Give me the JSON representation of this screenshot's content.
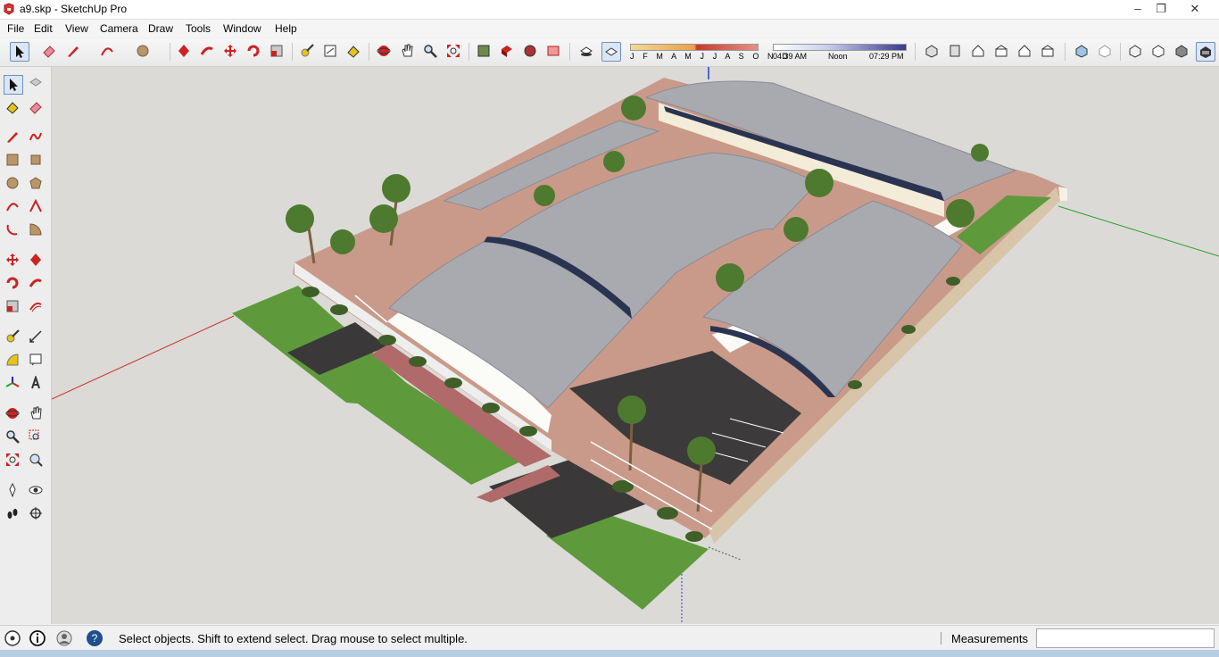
{
  "window": {
    "title": "a9.skp - SketchUp Pro",
    "controls": [
      "–",
      "❐",
      "✕"
    ]
  },
  "menu": [
    "File",
    "Edit",
    "View",
    "Camera",
    "Draw",
    "Tools",
    "Window",
    "Help"
  ],
  "toolbar": {
    "shadow_months": "J F M A M J J A S O N D",
    "time_start": "04:39 AM",
    "time_mid": "Noon",
    "time_end": "07:29 PM"
  },
  "status": {
    "hint": "Select objects. Shift to extend select. Drag mouse to select multiple.",
    "measurements_label": "Measurements",
    "measurements_value": ""
  },
  "colors": {
    "roof": "#a8aab0",
    "grass": "#5e9a3c",
    "paving": "#3c3a3a",
    "walk": "#b06a6a",
    "wall": "#fbfbf8",
    "sky": "#dcdad6"
  },
  "icons": [
    "select-icon",
    "eraser-icon",
    "pencil-icon",
    "arc-icon",
    "rectangle-icon",
    "circle-icon",
    "move-icon",
    "rotate-icon",
    "scale-icon",
    "tape-icon",
    "text-icon",
    "paint-icon",
    "orbit-icon",
    "pan-icon",
    "zoom-icon",
    "zoom-extents-icon",
    "walk-icon",
    "look-icon",
    "section-icon",
    "house-icon"
  ]
}
